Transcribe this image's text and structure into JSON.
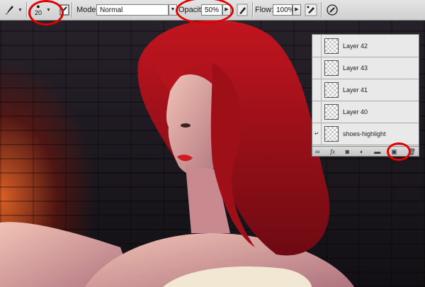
{
  "options_bar": {
    "brush_size": "20",
    "mode_label": "Mode:",
    "mode_value": "Normal",
    "opacity_label": "Opacity:",
    "opacity_value": "50%",
    "flow_label": "Flow:",
    "flow_value": "100%"
  },
  "layers_panel": {
    "layers": [
      {
        "name": "Layer 42"
      },
      {
        "name": "Layer 43"
      },
      {
        "name": "Layer 41"
      },
      {
        "name": "Layer 40"
      },
      {
        "name": "shoes-highlight"
      }
    ]
  },
  "colors": {
    "annotation": "#e00000",
    "hair": "#a3121a",
    "background": "#1a1418"
  }
}
